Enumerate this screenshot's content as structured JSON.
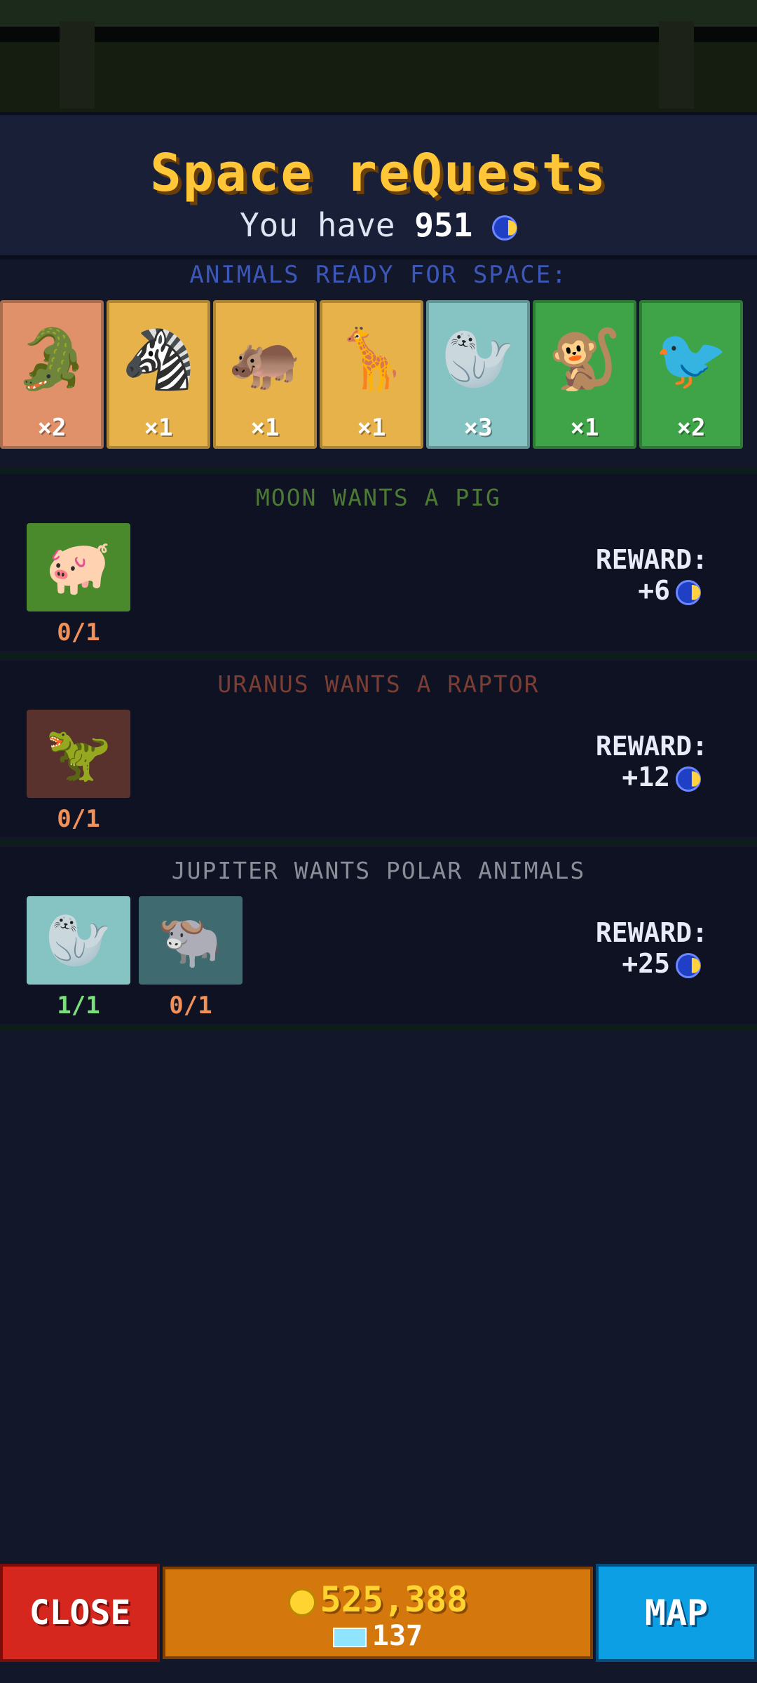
{
  "header": {
    "title": "Space reQuests",
    "balance_prefix": "You have",
    "balance_value": "951",
    "balance_icon": "moon-coin-icon"
  },
  "ready": {
    "label": "ANIMALS READY FOR SPACE:",
    "cards": [
      {
        "animal": "crocodile",
        "glyph": "🐊",
        "count": "×2",
        "color": "#e0916a"
      },
      {
        "animal": "zebra",
        "glyph": "🦓",
        "count": "×1",
        "color": "#e7b24a"
      },
      {
        "animal": "hippo",
        "glyph": "🦛",
        "count": "×1",
        "color": "#e7b24a"
      },
      {
        "animal": "giraffe",
        "glyph": "🦒",
        "count": "×1",
        "color": "#e7b24a"
      },
      {
        "animal": "seal",
        "glyph": "🦭",
        "count": "×3",
        "color": "#86c4c4"
      },
      {
        "animal": "monkey",
        "glyph": "🐒",
        "count": "×1",
        "color": "#3fa447"
      },
      {
        "animal": "toucan",
        "glyph": "🐦",
        "count": "×2",
        "color": "#3fa447"
      }
    ]
  },
  "quests": [
    {
      "title": "MOON WANTS A PIG",
      "title_color": "#4c7a33",
      "reward_label": "REWARD:",
      "reward_amount": "+6",
      "slots": [
        {
          "animal": "pig",
          "glyph": "🐖",
          "progress": "0/1",
          "color": "#4a8a2c",
          "progress_color": "#f0915a"
        }
      ]
    },
    {
      "title": "URANUS WANTS A RAPTOR",
      "title_color": "#7a3e35",
      "reward_label": "REWARD:",
      "reward_amount": "+12",
      "slots": [
        {
          "animal": "raptor",
          "glyph": "🦖",
          "progress": "0/1",
          "color": "#5a322d",
          "progress_color": "#f0915a"
        }
      ]
    },
    {
      "title": "JUPITER WANTS POLAR ANIMALS",
      "title_color": "#8a8e99",
      "reward_label": "REWARD:",
      "reward_amount": "+25",
      "slots": [
        {
          "animal": "seal",
          "glyph": "🦭",
          "progress": "1/1",
          "color": "#86c4c4",
          "progress_color": "#7be07b"
        },
        {
          "animal": "musk-ox",
          "glyph": "🐃",
          "progress": "0/1",
          "color": "#3f6b70",
          "progress_color": "#f0915a"
        }
      ]
    }
  ],
  "footer": {
    "close_label": "CLOSE",
    "coins": "525,388",
    "gems": "137",
    "map_label": "MAP"
  }
}
